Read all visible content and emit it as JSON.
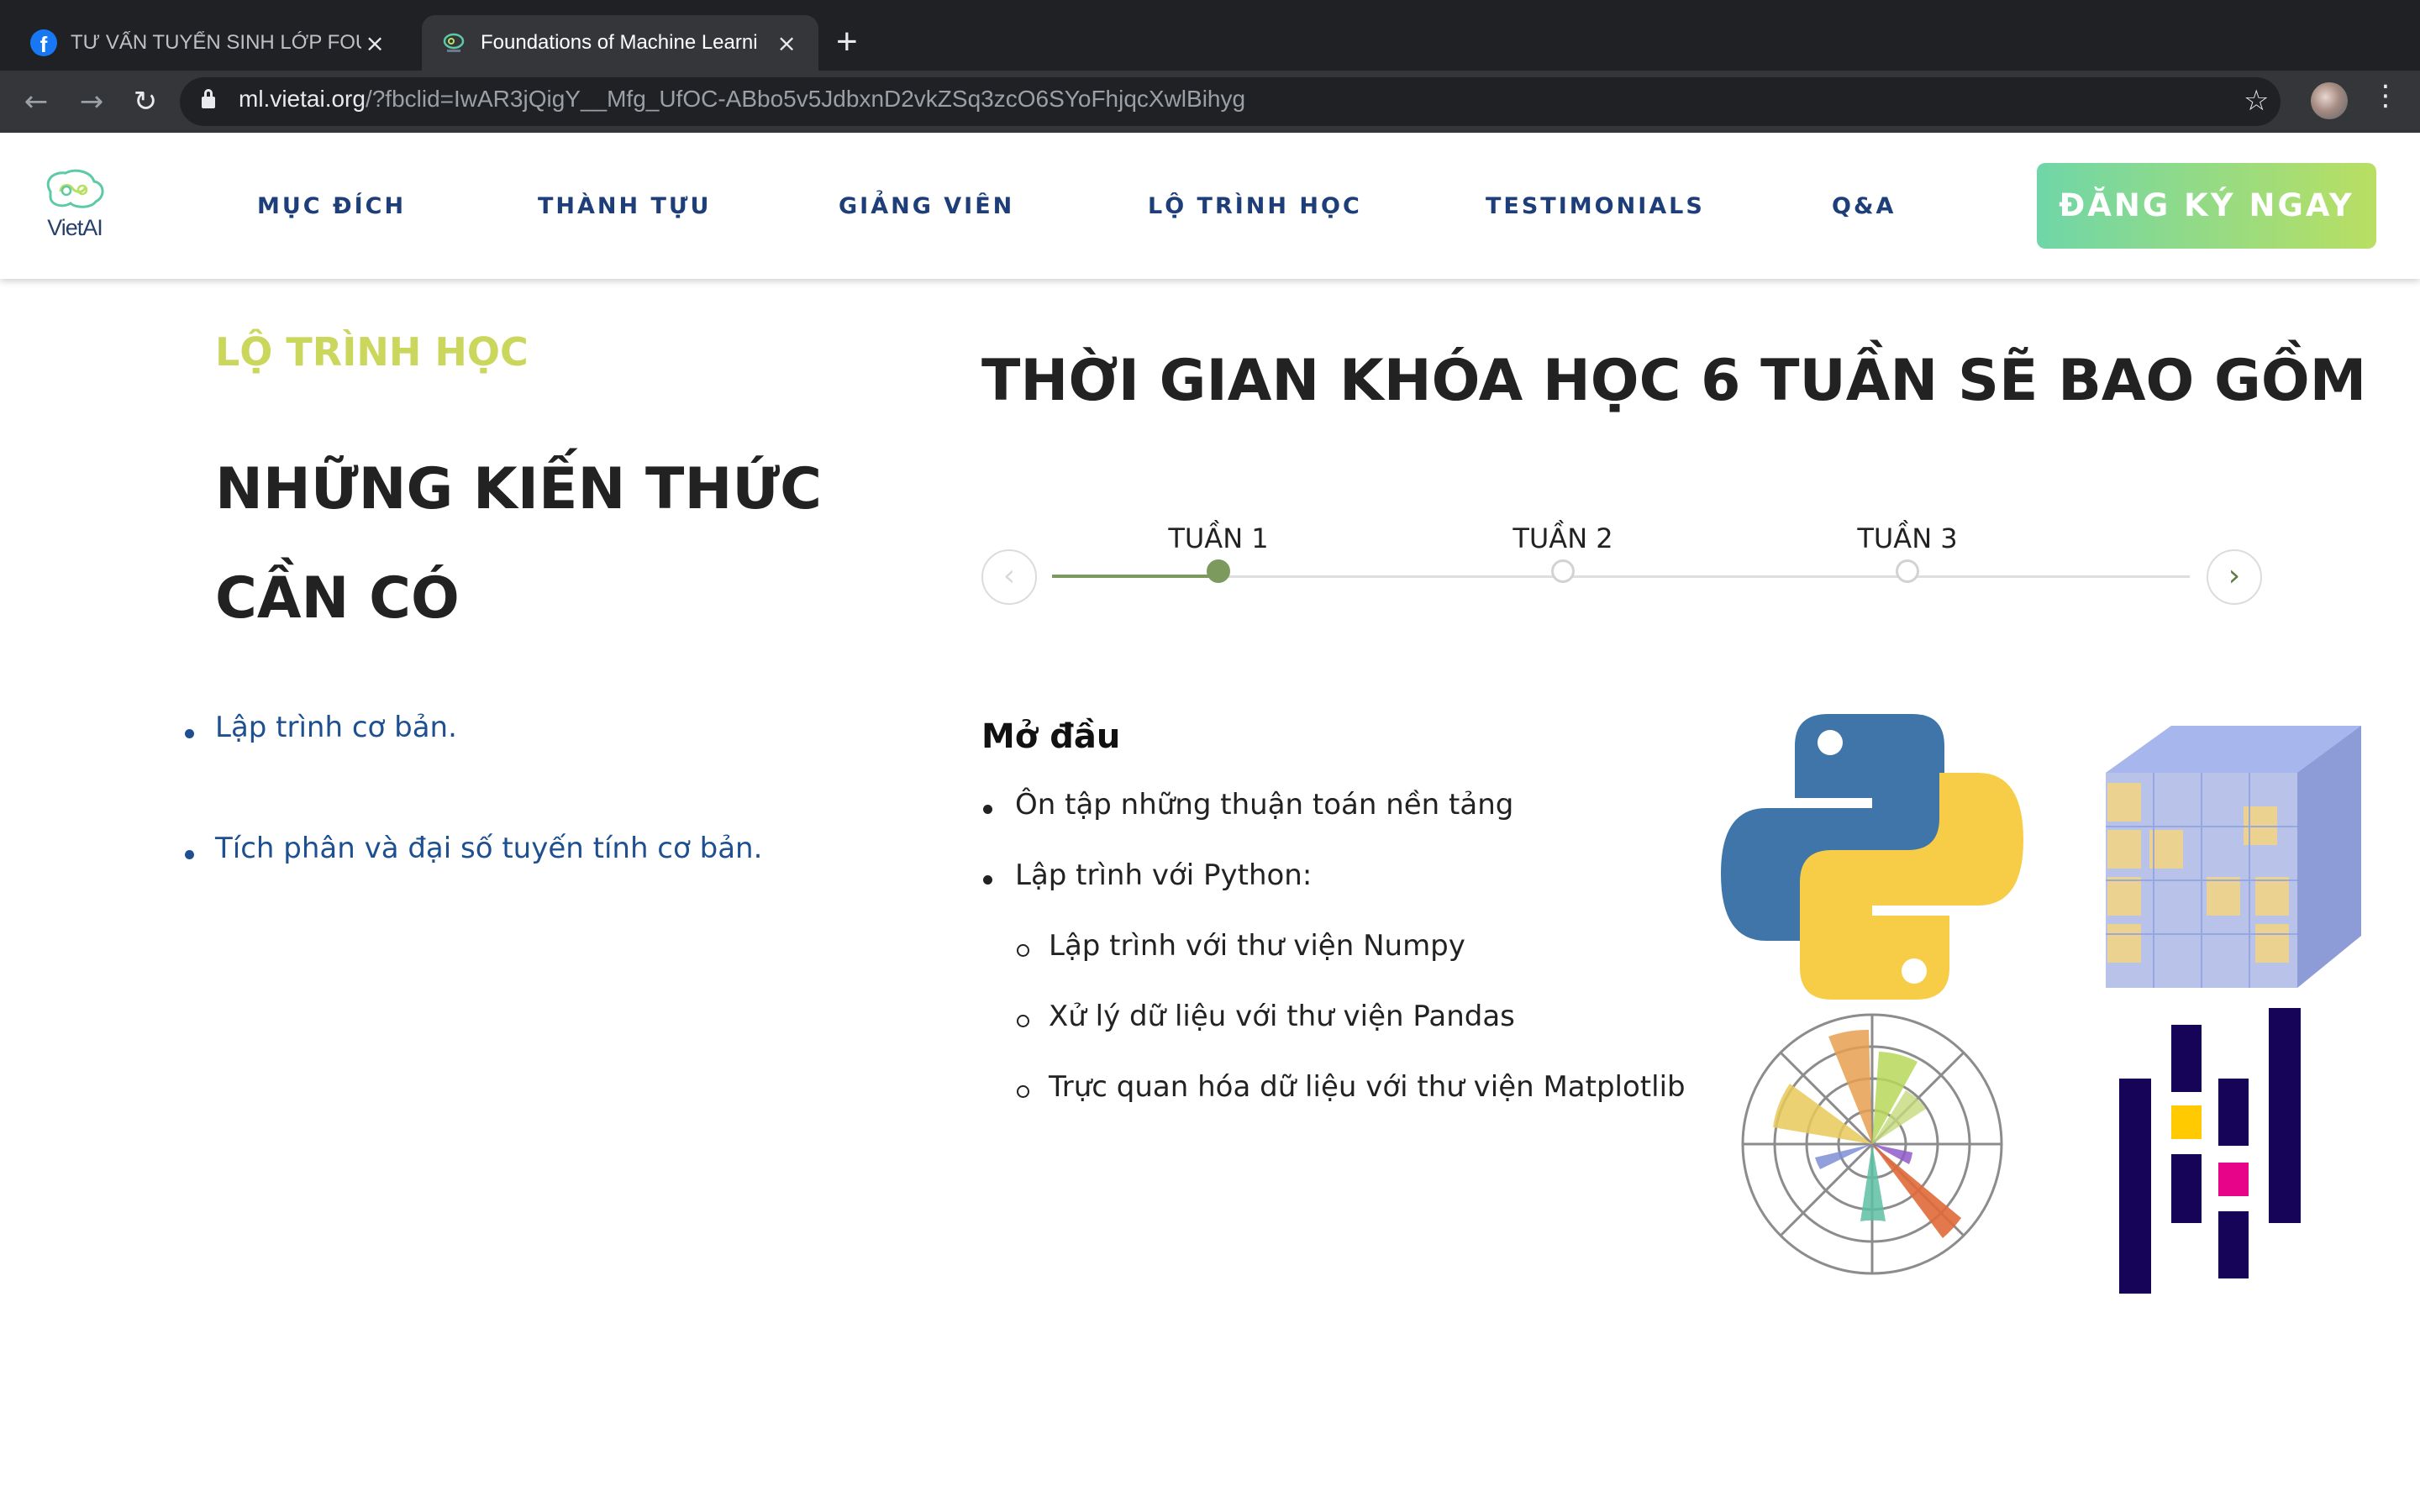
{
  "browser": {
    "tabs": [
      {
        "title": "TƯ VẤN TUYỂN SINH LỚP FOU",
        "close": "×"
      },
      {
        "title": "Foundations of Machine Learni",
        "close": "×"
      }
    ],
    "new_tab": "+",
    "url_host": "ml.vietai.org",
    "url_path": "/?fbclid=IwAR3jQigY__Mfg_UfOC-ABbo5v5JdbxnD2vkZSq3zcO6SYoFhjqcXwlBihyg",
    "icons": {
      "back": "←",
      "forward": "→",
      "reload": "↻",
      "star": "☆",
      "menu": "⋮",
      "facebook": "f"
    }
  },
  "header": {
    "logo_text": "VietAI",
    "nav": [
      "MỤC ĐÍCH",
      "THÀNH TỰU",
      "GIẢNG VIÊN",
      "LỘ TRÌNH HỌC",
      "TESTIMONIALS",
      "Q&A"
    ],
    "cta": "ĐĂNG KÝ NGAY"
  },
  "prereq": {
    "label": "LỘ TRÌNH HỌC",
    "title": "NHỮNG KIẾN THỨC CẦN CÓ",
    "items": [
      "Lập trình cơ bản.",
      "Tích phân và đại số tuyến tính cơ bản."
    ]
  },
  "course": {
    "title": "THỜI GIAN KHÓA HỌC 6 TUẦN SẼ BAO GỒM",
    "weeks": [
      "TUẦN 1",
      "TUẦN 2",
      "TUẦN 3"
    ],
    "active_week": 1,
    "prev": "‹",
    "next": "›",
    "section_title": "Mở đầu",
    "items": [
      "Ôn tập những thuận toán nền tảng",
      "Lập trình với Python:",
      "Lập trình với thư viện Numpy",
      "Xử lý dữ liệu với thư viện Pandas",
      "Trực quan hóa dữ liệu với thư viện Matplotlib"
    ],
    "library_icons": [
      "python-logo-icon",
      "numpy-logo-icon",
      "matplotlib-logo-icon",
      "pandas-logo-icon"
    ]
  },
  "colors": {
    "nav_text": "#1d3e78",
    "label_green": "#cbd65c",
    "cta_start": "#6fd6a8",
    "cta_end": "#b9df62",
    "link_blue": "#1d4f91",
    "progress_green": "#7c9a5e"
  }
}
